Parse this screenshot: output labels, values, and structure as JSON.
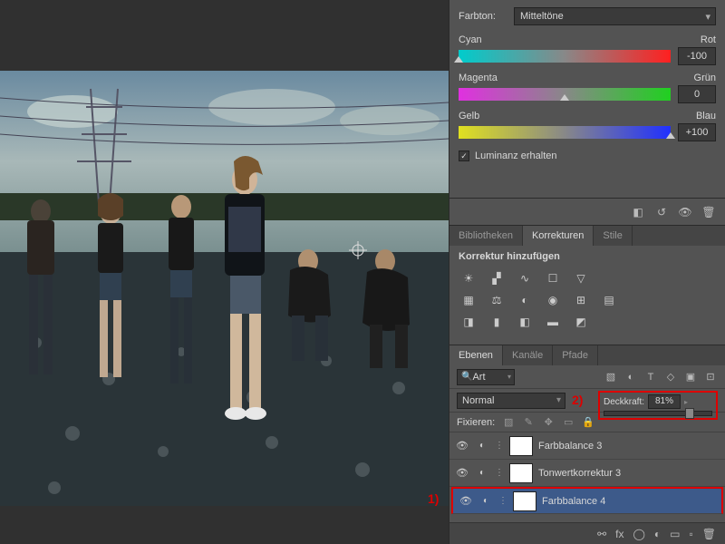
{
  "colorBalance": {
    "toneLabel": "Farbton:",
    "toneValue": "Mitteltöne",
    "sliders": [
      {
        "left": "Cyan",
        "right": "Rot",
        "value": "-100",
        "pos": 0,
        "grad": "linear-gradient(90deg,#00cccc,#888,#ff2020)"
      },
      {
        "left": "Magenta",
        "right": "Grün",
        "value": "0",
        "pos": 50,
        "grad": "linear-gradient(90deg,#e030e0,#888,#20d020)"
      },
      {
        "left": "Gelb",
        "right": "Blau",
        "value": "+100",
        "pos": 100,
        "grad": "linear-gradient(90deg,#e0e020,#888,#2030ff)"
      }
    ],
    "preserveLum": "Luminanz erhalten"
  },
  "adjustments": {
    "tabs": [
      "Bibliotheken",
      "Korrekturen",
      "Stile"
    ],
    "activeTab": 1,
    "title": "Korrektur hinzufügen"
  },
  "layersPanel": {
    "tabs": [
      "Ebenen",
      "Kanäle",
      "Pfade"
    ],
    "activeTab": 0,
    "filterLabel": "Art",
    "blendMode": "Normal",
    "opacityLabel": "Deckkraft:",
    "opacityValue": "81%",
    "opacityPos": 81,
    "lockLabel": "Fixieren:",
    "layers": [
      {
        "name": "Farbbalance 3",
        "selected": false,
        "visible": true
      },
      {
        "name": "Tonwertkorrektur 3",
        "selected": false,
        "visible": true
      },
      {
        "name": "Farbbalance 4",
        "selected": true,
        "visible": true
      }
    ]
  },
  "annotations": {
    "a1": "1)",
    "a2": "2)"
  }
}
